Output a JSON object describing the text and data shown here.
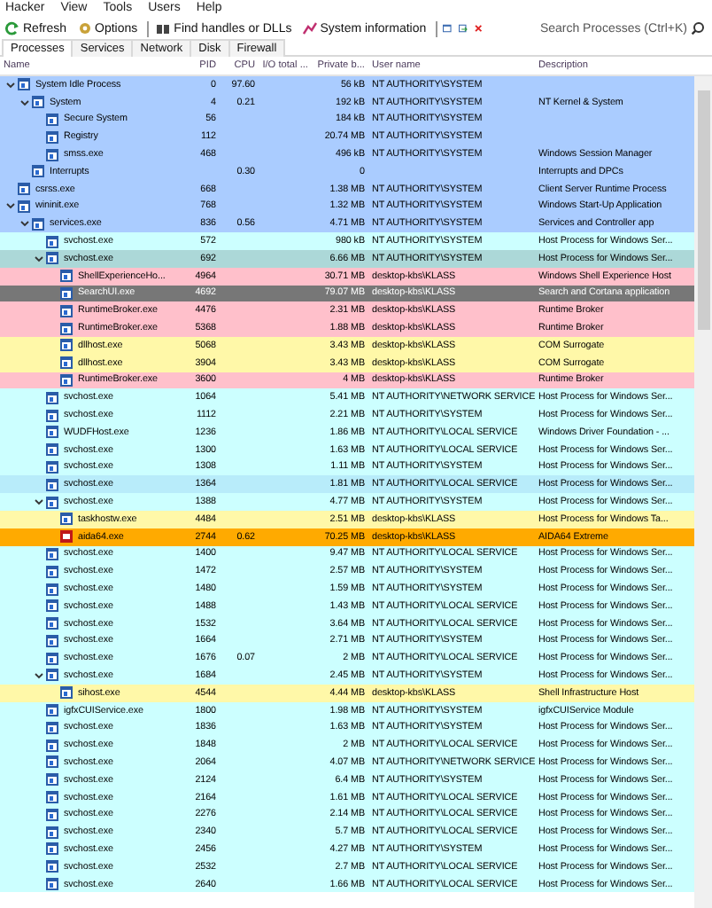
{
  "menu": [
    "Hacker",
    "View",
    "Tools",
    "Users",
    "Help"
  ],
  "toolbar": {
    "buttons": [
      {
        "label": "Refresh",
        "kind": "refresh"
      },
      {
        "label": "Options",
        "kind": "options"
      },
      {
        "label": "Find handles or DLLs",
        "kind": "find"
      },
      {
        "label": "System information",
        "kind": "sysinfo"
      }
    ],
    "search": {
      "placeholder": "Search Processes (Ctrl+K)"
    }
  },
  "tabs": [
    {
      "label": "Processes",
      "selected": true
    },
    {
      "label": "Services",
      "selected": false
    },
    {
      "label": "Network",
      "selected": false
    },
    {
      "label": "Disk",
      "selected": false
    },
    {
      "label": "Firewall",
      "selected": false
    }
  ],
  "columns": [
    "Name",
    "PID",
    "CPU",
    "I/O total ...",
    "Private b...",
    "User name",
    "Description"
  ],
  "processes": [
    {
      "name": "System Idle Process",
      "pid": "0",
      "cpu": "97.60",
      "private": "56 kB",
      "user": "NT AUTHORITY\\SYSTEM",
      "color": "#aaccff",
      "expanded": true,
      "children": [
        {
          "name": "System",
          "pid": "4",
          "cpu": "0.21",
          "private": "192 kB",
          "user": "NT AUTHORITY\\SYSTEM",
          "description": "NT Kernel & System",
          "color": "#aaccff",
          "expanded": true,
          "children": [
            {
              "name": "Secure System",
              "pid": "56",
              "private": "184 kB",
              "user": "NT AUTHORITY\\SYSTEM",
              "color": "#aaccff"
            },
            {
              "name": "Registry",
              "pid": "112",
              "private": "20.74 MB",
              "user": "NT AUTHORITY\\SYSTEM",
              "color": "#aaccff"
            },
            {
              "name": "smss.exe",
              "pid": "468",
              "private": "496 kB",
              "user": "NT AUTHORITY\\SYSTEM",
              "description": "Windows Session Manager",
              "color": "#aaccff"
            }
          ]
        },
        {
          "name": "Interrupts",
          "cpu": "0.30",
          "private": "0",
          "description": "Interrupts and DPCs",
          "color": "#aaccff"
        }
      ]
    },
    {
      "name": "csrss.exe",
      "pid": "668",
      "private": "1.38 MB",
      "user": "NT AUTHORITY\\SYSTEM",
      "description": "Client Server Runtime Process",
      "color": "#aaccff"
    },
    {
      "name": "wininit.exe",
      "pid": "768",
      "private": "1.32 MB",
      "user": "NT AUTHORITY\\SYSTEM",
      "description": "Windows Start-Up Application",
      "color": "#aaccff",
      "expanded": true,
      "children": [
        {
          "name": "services.exe",
          "pid": "836",
          "cpu": "0.56",
          "private": "4.71 MB",
          "user": "NT AUTHORITY\\SYSTEM",
          "description": "Services and Controller app",
          "color": "#aaccff",
          "expanded": true,
          "children": [
            {
              "name": "svchost.exe",
              "pid": "572",
              "private": "980 kB",
              "user": "NT AUTHORITY\\SYSTEM",
              "description": "Host Process for Windows Ser...",
              "color": "#ccffff"
            },
            {
              "name": "svchost.exe",
              "pid": "692",
              "private": "6.66 MB",
              "user": "NT AUTHORITY\\SYSTEM",
              "description": "Host Process for Windows Ser...",
              "color": "#acd8d8",
              "expanded": true,
              "children": [
                {
                  "name": "ShellExperienceHo...",
                  "pid": "4964",
                  "private": "30.71 MB",
                  "user": "desktop-kbs\\KLASS",
                  "description": "Windows Shell Experience Host",
                  "color": "#ffc0cb"
                },
                {
                  "name": "SearchUI.exe",
                  "pid": "4692",
                  "private": "79.07 MB",
                  "user": "desktop-kbs\\KLASS",
                  "description": "Search and Cortana application",
                  "color": "#777777"
                },
                {
                  "name": "RuntimeBroker.exe",
                  "pid": "4476",
                  "private": "2.31 MB",
                  "user": "desktop-kbs\\KLASS",
                  "description": "Runtime Broker",
                  "color": "#ffc0cb"
                },
                {
                  "name": "RuntimeBroker.exe",
                  "pid": "5368",
                  "private": "1.88 MB",
                  "user": "desktop-kbs\\KLASS",
                  "description": "Runtime Broker",
                  "color": "#ffc0cb"
                },
                {
                  "name": "dllhost.exe",
                  "pid": "5068",
                  "private": "3.43 MB",
                  "user": "desktop-kbs\\KLASS",
                  "description": "COM Surrogate",
                  "color": "#fff8a8"
                },
                {
                  "name": "dllhost.exe",
                  "pid": "3904",
                  "private": "3.43 MB",
                  "user": "desktop-kbs\\KLASS",
                  "description": "COM Surrogate",
                  "color": "#fff8a8"
                },
                {
                  "name": "RuntimeBroker.exe",
                  "pid": "3600",
                  "private": "4 MB",
                  "user": "desktop-kbs\\KLASS",
                  "description": "Runtime Broker",
                  "color": "#ffc0cb"
                }
              ]
            },
            {
              "name": "svchost.exe",
              "pid": "1064",
              "private": "5.41 MB",
              "user": "NT AUTHORITY\\NETWORK SERVICE",
              "description": "Host Process for Windows Ser...",
              "color": "#ccffff"
            },
            {
              "name": "svchost.exe",
              "pid": "1112",
              "private": "2.21 MB",
              "user": "NT AUTHORITY\\SYSTEM",
              "description": "Host Process for Windows Ser...",
              "color": "#ccffff"
            },
            {
              "name": "WUDFHost.exe",
              "pid": "1236",
              "private": "1.86 MB",
              "user": "NT AUTHORITY\\LOCAL SERVICE",
              "description": "Windows Driver Foundation - ...",
              "color": "#ccffff"
            },
            {
              "name": "svchost.exe",
              "pid": "1300",
              "private": "1.63 MB",
              "user": "NT AUTHORITY\\LOCAL SERVICE",
              "description": "Host Process for Windows Ser...",
              "color": "#ccffff"
            },
            {
              "name": "svchost.exe",
              "pid": "1308",
              "private": "1.11 MB",
              "user": "NT AUTHORITY\\SYSTEM",
              "description": "Host Process for Windows Ser...",
              "color": "#ccffff"
            },
            {
              "name": "svchost.exe",
              "pid": "1364",
              "private": "1.81 MB",
              "user": "NT AUTHORITY\\LOCAL SERVICE",
              "description": "Host Process for Windows Ser...",
              "color": "#b8ecfa"
            },
            {
              "name": "svchost.exe",
              "pid": "1388",
              "private": "4.77 MB",
              "user": "NT AUTHORITY\\SYSTEM",
              "description": "Host Process for Windows Ser...",
              "color": "#ccffff",
              "expanded": true,
              "children": [
                {
                  "name": "taskhostw.exe",
                  "pid": "4484",
                  "private": "2.51 MB",
                  "user": "desktop-kbs\\KLASS",
                  "description": "Host Process for Windows Ta...",
                  "color": "#fff8a8"
                },
                {
                  "name": "aida64.exe",
                  "pid": "2744",
                  "cpu": "0.62",
                  "private": "70.25 MB",
                  "user": "desktop-kbs\\KLASS",
                  "description": "AIDA64 Extreme",
                  "color": "#ffaa00",
                  "kind": "app"
                }
              ]
            },
            {
              "name": "svchost.exe",
              "pid": "1400",
              "private": "9.47 MB",
              "user": "NT AUTHORITY\\LOCAL SERVICE",
              "description": "Host Process for Windows Ser...",
              "color": "#ccffff"
            },
            {
              "name": "svchost.exe",
              "pid": "1472",
              "private": "2.57 MB",
              "user": "NT AUTHORITY\\SYSTEM",
              "description": "Host Process for Windows Ser...",
              "color": "#ccffff"
            },
            {
              "name": "svchost.exe",
              "pid": "1480",
              "private": "1.59 MB",
              "user": "NT AUTHORITY\\SYSTEM",
              "description": "Host Process for Windows Ser...",
              "color": "#ccffff"
            },
            {
              "name": "svchost.exe",
              "pid": "1488",
              "private": "1.43 MB",
              "user": "NT AUTHORITY\\LOCAL SERVICE",
              "description": "Host Process for Windows Ser...",
              "color": "#ccffff"
            },
            {
              "name": "svchost.exe",
              "pid": "1532",
              "private": "3.64 MB",
              "user": "NT AUTHORITY\\LOCAL SERVICE",
              "description": "Host Process for Windows Ser...",
              "color": "#ccffff"
            },
            {
              "name": "svchost.exe",
              "pid": "1664",
              "private": "2.71 MB",
              "user": "NT AUTHORITY\\SYSTEM",
              "description": "Host Process for Windows Ser...",
              "color": "#ccffff"
            },
            {
              "name": "svchost.exe",
              "pid": "1676",
              "cpu": "0.07",
              "private": "2 MB",
              "user": "NT AUTHORITY\\LOCAL SERVICE",
              "description": "Host Process for Windows Ser...",
              "color": "#ccffff"
            },
            {
              "name": "svchost.exe",
              "pid": "1684",
              "private": "2.45 MB",
              "user": "NT AUTHORITY\\SYSTEM",
              "description": "Host Process for Windows Ser...",
              "color": "#ccffff",
              "expanded": true,
              "children": [
                {
                  "name": "sihost.exe",
                  "pid": "4544",
                  "private": "4.44 MB",
                  "user": "desktop-kbs\\KLASS",
                  "description": "Shell Infrastructure Host",
                  "color": "#fff8a8"
                }
              ]
            },
            {
              "name": "igfxCUIService.exe",
              "pid": "1800",
              "private": "1.98 MB",
              "user": "NT AUTHORITY\\SYSTEM",
              "description": "igfxCUIService Module",
              "color": "#ccffff"
            },
            {
              "name": "svchost.exe",
              "pid": "1836",
              "private": "1.63 MB",
              "user": "NT AUTHORITY\\SYSTEM",
              "description": "Host Process for Windows Ser...",
              "color": "#ccffff"
            },
            {
              "name": "svchost.exe",
              "pid": "1848",
              "private": "2 MB",
              "user": "NT AUTHORITY\\LOCAL SERVICE",
              "description": "Host Process for Windows Ser...",
              "color": "#ccffff"
            },
            {
              "name": "svchost.exe",
              "pid": "2064",
              "private": "4.07 MB",
              "user": "NT AUTHORITY\\NETWORK SERVICE",
              "description": "Host Process for Windows Ser...",
              "color": "#ccffff"
            },
            {
              "name": "svchost.exe",
              "pid": "2124",
              "private": "6.4 MB",
              "user": "NT AUTHORITY\\SYSTEM",
              "description": "Host Process for Windows Ser...",
              "color": "#ccffff"
            },
            {
              "name": "svchost.exe",
              "pid": "2164",
              "private": "1.61 MB",
              "user": "NT AUTHORITY\\LOCAL SERVICE",
              "description": "Host Process for Windows Ser...",
              "color": "#ccffff"
            },
            {
              "name": "svchost.exe",
              "pid": "2276",
              "private": "2.14 MB",
              "user": "NT AUTHORITY\\LOCAL SERVICE",
              "description": "Host Process for Windows Ser...",
              "color": "#ccffff"
            },
            {
              "name": "svchost.exe",
              "pid": "2340",
              "private": "5.7 MB",
              "user": "NT AUTHORITY\\LOCAL SERVICE",
              "description": "Host Process for Windows Ser...",
              "color": "#ccffff"
            },
            {
              "name": "svchost.exe",
              "pid": "2456",
              "private": "4.27 MB",
              "user": "NT AUTHORITY\\SYSTEM",
              "description": "Host Process for Windows Ser...",
              "color": "#ccffff"
            },
            {
              "name": "svchost.exe",
              "pid": "2532",
              "private": "2.7 MB",
              "user": "NT AUTHORITY\\LOCAL SERVICE",
              "description": "Host Process for Windows Ser...",
              "color": "#ccffff"
            },
            {
              "name": "svchost.exe",
              "pid": "2640",
              "private": "1.66 MB",
              "user": "NT AUTHORITY\\LOCAL SERVICE",
              "description": "Host Process for Windows Ser...",
              "color": "#ccffff"
            }
          ]
        }
      ]
    }
  ]
}
